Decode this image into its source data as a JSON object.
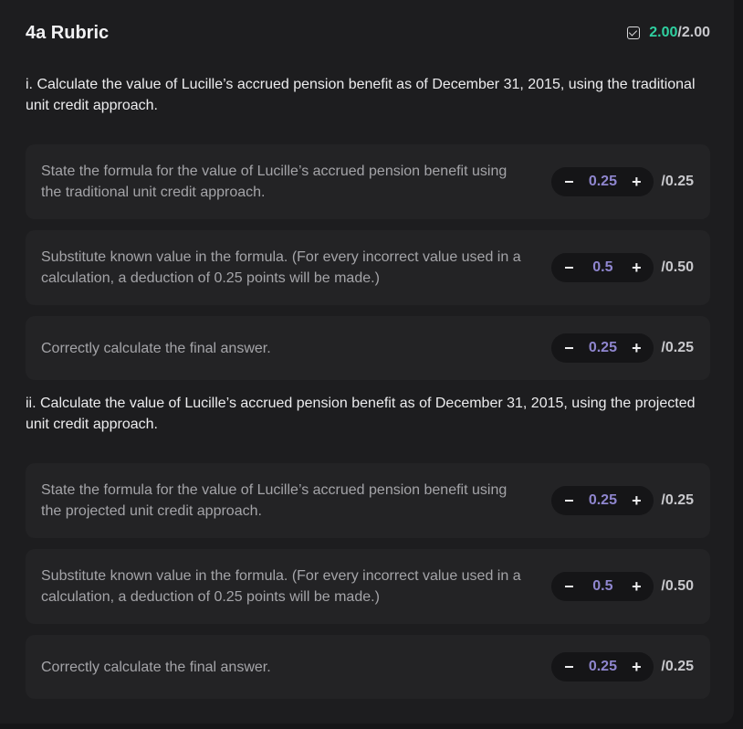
{
  "header": {
    "title": "4a Rubric",
    "score_earned": "2.00",
    "score_total": "/2.00",
    "check_icon": "checkbox-checked-icon",
    "accent_color": "#2fd0a0"
  },
  "sections": [
    {
      "title": "i. Calculate the value of Lucille’s accrued pension benefit as of December 31, 2015, using the traditional unit credit approach.",
      "items": [
        {
          "text": "State the formula for the value of Lucille’s accrued pension benefit using the traditional unit credit approach.",
          "value": "0.25",
          "max": "/0.25"
        },
        {
          "text": "Substitute known value in the formula. (For every incorrect value used in a calculation, a deduction of 0.25 points will be made.)",
          "value": "0.5",
          "max": "/0.50"
        },
        {
          "text": "Correctly calculate the final answer.",
          "value": "0.25",
          "max": "/0.25"
        }
      ]
    },
    {
      "title": "ii. Calculate the value of Lucille’s accrued pension benefit as of December 31, 2015, using the projected unit credit approach.",
      "items": [
        {
          "text": "State the formula for the value of Lucille’s accrued pension benefit using the projected unit credit approach.",
          "value": "0.25",
          "max": "/0.25"
        },
        {
          "text": "Substitute known value in the formula. (For every incorrect value used in a calculation, a deduction of 0.25 points will be made.)",
          "value": "0.5",
          "max": "/0.50"
        },
        {
          "text": "Correctly calculate the final answer.",
          "value": "0.25",
          "max": "/0.25"
        }
      ]
    }
  ],
  "stepper": {
    "minus": "−",
    "plus": "+"
  }
}
